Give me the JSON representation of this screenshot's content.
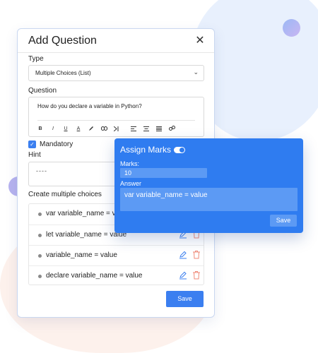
{
  "dialog": {
    "title": "Add Question",
    "close_icon": "close-icon",
    "type": {
      "label": "Type",
      "selected": "Multiple Choices (List)",
      "chevron_icon": "chevron-down-icon"
    },
    "question": {
      "label": "Question",
      "text": "How do you declare a variable in Python?",
      "toolbar": [
        "bold-icon",
        "italic-icon",
        "underline-icon",
        "font-color-icon",
        "highlight-icon",
        "link-icon",
        "paragraph-icon",
        "align-left-icon",
        "align-center-icon",
        "align-justify-icon",
        "unlink-icon"
      ],
      "toolbar_glyphs": {
        "bold": "B",
        "italic": "I",
        "underline": "U",
        "font_color": "A"
      }
    },
    "mandatory": {
      "label": "Mandatory",
      "checked": true
    },
    "hint": {
      "label": "Hint",
      "placeholder": "----"
    },
    "choices": {
      "label": "Create multiple choices",
      "items": [
        {
          "text": "var variable_name = value"
        },
        {
          "text": "let variable_name = value"
        },
        {
          "text": "variable_name = value"
        },
        {
          "text": "declare variable_name = value"
        }
      ]
    },
    "save_label": "Save"
  },
  "assign_marks": {
    "title": "Assign Marks",
    "toggle_on": true,
    "marks_label": "Marks:",
    "marks_value": "10",
    "answer_label": "Answer",
    "answer_value": "var variable_name = value",
    "save_label": "Save"
  },
  "colors": {
    "accent": "#3b7ff0",
    "popover_bg": "#2f7cf0",
    "popover_field": "#5c9af4"
  }
}
